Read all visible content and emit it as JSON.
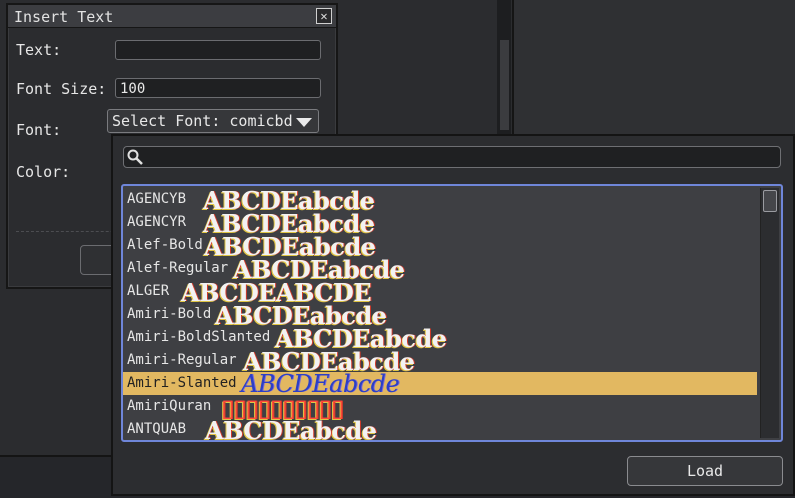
{
  "dialog": {
    "title": "Insert Text",
    "text_label": "Text:",
    "text_value": "",
    "font_size_label": "Font Size:",
    "font_size_value": "100",
    "font_label": "Font:",
    "font_select_value": "Select Font: comicbd",
    "color_label": "Color:"
  },
  "font_picker": {
    "search_placeholder": "",
    "fonts": [
      {
        "name": "AGENCYB",
        "sample": "ABCDEabcde",
        "selected": false
      },
      {
        "name": "AGENCYR",
        "sample": "ABCDEabcde",
        "selected": false
      },
      {
        "name": "Alef-Bold",
        "sample": "ABCDEabcde",
        "selected": false
      },
      {
        "name": "Alef-Regular",
        "sample": "ABCDEabcde",
        "selected": false
      },
      {
        "name": "ALGER",
        "sample": "ABCDEABCDE",
        "selected": false
      },
      {
        "name": "Amiri-Bold",
        "sample": "ABCDEabcde",
        "selected": false
      },
      {
        "name": "Amiri-BoldSlanted",
        "sample": "ABCDEabcde",
        "selected": false
      },
      {
        "name": "Amiri-Regular",
        "sample": "ABCDEabcde",
        "selected": false
      },
      {
        "name": "Amiri-Slanted",
        "sample": "ABCDEabcde",
        "selected": true
      },
      {
        "name": "AmiriQuran",
        "sample": "▯▯▯▯▯▯▯▯▯▯",
        "selected": false
      },
      {
        "name": "ANTQUAB",
        "sample": "ABCDEabcde",
        "selected": false
      }
    ],
    "load_label": "Load"
  },
  "colors": {
    "selected_row": "#e2b861",
    "list_border": "#6f86d9"
  }
}
